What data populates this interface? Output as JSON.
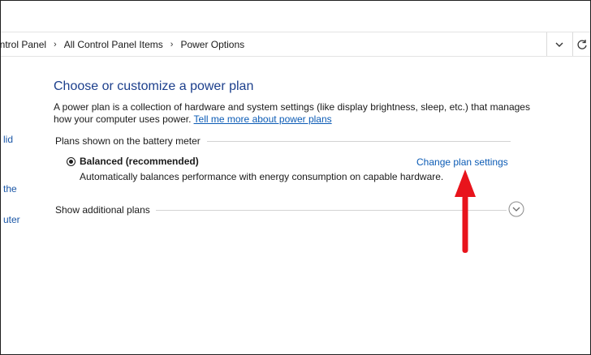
{
  "breadcrumb": {
    "items": [
      "ontrol Panel",
      "All Control Panel Items",
      "Power Options"
    ],
    "separator": "›"
  },
  "sidebar": {
    "fragments": [
      "lid",
      "the",
      "uter"
    ]
  },
  "main": {
    "title": "Choose or customize a power plan",
    "description": "A power plan is a collection of hardware and system settings (like display brightness, sleep, etc.) that manages how your computer uses power.",
    "learn_more_link": "Tell me more about power plans",
    "battery_section_label": "Plans shown on the battery meter",
    "plan": {
      "name": "Balanced (recommended)",
      "description": "Automatically balances performance with energy consumption on capable hardware.",
      "selected": true,
      "change_link": "Change plan settings"
    },
    "additional_plans_label": "Show additional plans"
  },
  "colors": {
    "heading": "#1c3f8c",
    "link": "#0b5bb5",
    "arrow": "#e8141c"
  },
  "icons": {
    "dropdown": "chevron-down-icon",
    "refresh": "refresh-icon",
    "expand": "circle-chevron-down-icon",
    "annotation": "red-arrow-icon"
  }
}
